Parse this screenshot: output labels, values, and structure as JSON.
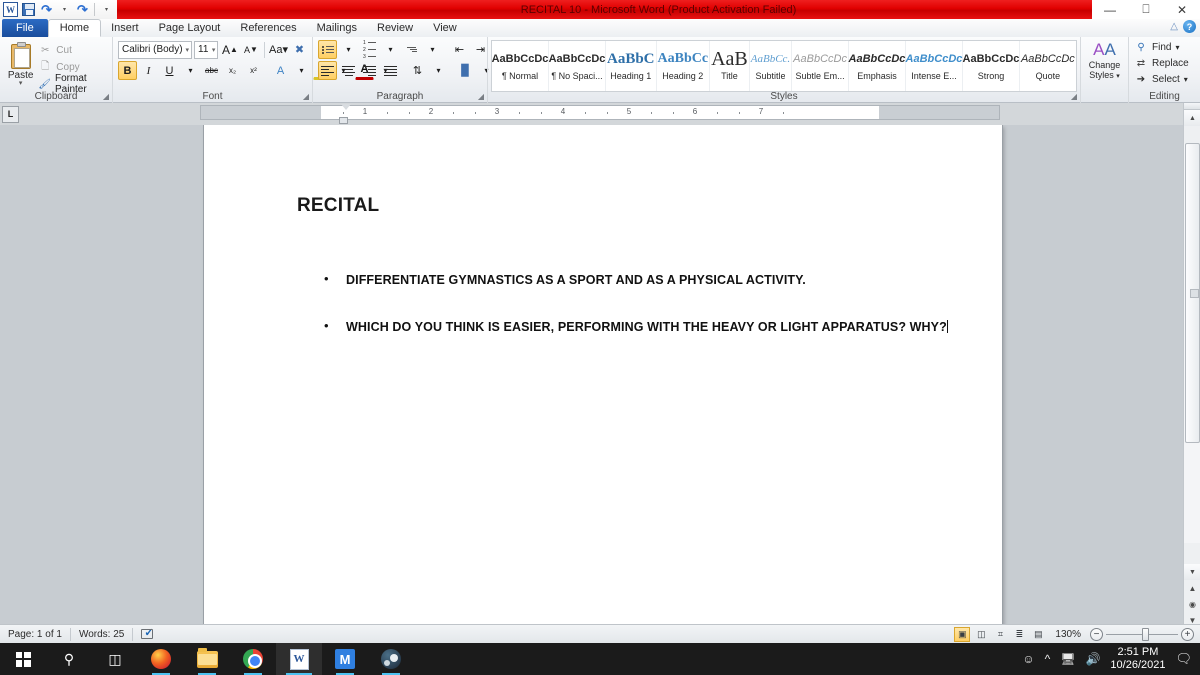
{
  "window": {
    "title": "RECITAL 10  -  Microsoft Word (Product Activation Failed)",
    "minimize": "—",
    "restore": "❐",
    "close": "✕",
    "minimize_ribbon_icon": "chevron-up-icon",
    "help_icon": "?"
  },
  "quick_access": {
    "word_icon": "W",
    "save_icon": "save-icon",
    "undo_icon": "↶",
    "redo_icon": "↷",
    "customize_icon": "▾"
  },
  "tabs": [
    {
      "label": "File",
      "active": false
    },
    {
      "label": "Home",
      "active": true
    },
    {
      "label": "Insert",
      "active": false
    },
    {
      "label": "Page Layout",
      "active": false
    },
    {
      "label": "References",
      "active": false
    },
    {
      "label": "Mailings",
      "active": false
    },
    {
      "label": "Review",
      "active": false
    },
    {
      "label": "View",
      "active": false
    }
  ],
  "ribbon": {
    "clipboard": {
      "group_label": "Clipboard",
      "paste_label": "Paste",
      "paste_caret": "▾",
      "cut_label": "Cut",
      "copy_label": "Copy",
      "format_painter_label": "Format Painter"
    },
    "font": {
      "group_label": "Font",
      "font_name": "Calibri (Body)",
      "font_size": "11",
      "grow_font": "A",
      "shrink_font": "A",
      "change_case": "Aa",
      "clear_formatting": "clear-formatting-icon",
      "bold": "B",
      "italic": "I",
      "underline": "U",
      "strikethrough": "abc",
      "subscript": "x₂",
      "superscript": "x²",
      "text_effects": "A",
      "highlight": "highlight-icon",
      "font_color": "A"
    },
    "paragraph": {
      "group_label": "Paragraph",
      "bullets": "bullets-icon",
      "numbering": "numbering-icon",
      "multilevel": "multilevel-list-icon",
      "decrease_indent": "decrease-indent-icon",
      "increase_indent": "increase-indent-icon",
      "sort": "sort-icon",
      "show_marks": "¶",
      "align_left": "align-left-icon",
      "align_center": "align-center-icon",
      "align_right": "align-right-icon",
      "justify": "justify-icon",
      "line_spacing": "line-spacing-icon",
      "shading": "shading-icon",
      "borders": "borders-icon"
    },
    "styles": {
      "group_label": "Styles",
      "items": [
        {
          "preview": "AaBbCcDc",
          "name": "¶ Normal"
        },
        {
          "preview": "AaBbCcDc",
          "name": "¶ No Spaci..."
        },
        {
          "preview": "AaBbC",
          "name": "Heading 1"
        },
        {
          "preview": "AaBbCc",
          "name": "Heading 2"
        },
        {
          "preview": "AaB",
          "name": "Title"
        },
        {
          "preview": "AaBbCc.",
          "name": "Subtitle"
        },
        {
          "preview": "AaBbCcDc",
          "name": "Subtle Em..."
        },
        {
          "preview": "AaBbCcDc",
          "name": "Emphasis"
        },
        {
          "preview": "AaBbCcDc",
          "name": "Intense E..."
        },
        {
          "preview": "AaBbCcDc",
          "name": "Strong"
        },
        {
          "preview": "AaBbCcDc",
          "name": "Quote"
        }
      ],
      "scroll_up": "▴",
      "scroll_down": "▾",
      "more": "▾"
    },
    "change_styles": {
      "label_line1": "Change",
      "label_line2": "Styles",
      "caret": "▾"
    },
    "editing": {
      "group_label": "Editing",
      "find_label": "Find",
      "find_caret": "▾",
      "replace_label": "Replace",
      "select_label": "Select",
      "select_caret": "▾"
    }
  },
  "ruler": {
    "tab_selector": "L",
    "numbers": [
      "1",
      "2",
      "3",
      "4",
      "5",
      "6",
      "7"
    ]
  },
  "document": {
    "title": "RECITAL",
    "bullet_marker": "•",
    "bullets": [
      {
        "text": "DIFFERENTIATE GYMNASTICS AS A SPORT AND AS A PHYSICAL ACTIVITY."
      },
      {
        "text": "WHICH DO YOU THINK IS EASIER, PERFORMING WITH THE HEAVY OR LIGHT APPARATUS? WHY?"
      }
    ]
  },
  "status_bar": {
    "page": "Page: 1 of 1",
    "words": "Words: 25",
    "proofing_icon": "proofing-errors-icon",
    "views": [
      {
        "name": "print-layout-view",
        "glyph": "▣",
        "active": true
      },
      {
        "name": "full-screen-reading-view",
        "glyph": "◫",
        "active": false
      },
      {
        "name": "web-layout-view",
        "glyph": "⌗",
        "active": false
      },
      {
        "name": "outline-view",
        "glyph": "≣",
        "active": false
      },
      {
        "name": "draft-view",
        "glyph": "▤",
        "active": false
      }
    ],
    "zoom_out": "−",
    "zoom_in": "+",
    "zoom_level": "130%"
  },
  "taskbar": {
    "items": [
      {
        "name": "start-button",
        "label": "Start"
      },
      {
        "name": "search-icon",
        "label": "Search"
      },
      {
        "name": "task-view-icon",
        "label": "Task View"
      },
      {
        "name": "firefox-icon",
        "label": "Firefox"
      },
      {
        "name": "file-explorer-icon",
        "label": "File Explorer"
      },
      {
        "name": "chrome-icon",
        "label": "Google Chrome"
      },
      {
        "name": "word-icon",
        "label": "Microsoft Word"
      },
      {
        "name": "m-app-icon",
        "label": "M"
      },
      {
        "name": "steam-icon",
        "label": "Steam"
      }
    ],
    "tray": {
      "people_icon": "ʘ",
      "show_hidden_icon": "∧",
      "network_icon": "⌨",
      "volume_icon": "ᴘ",
      "time": "2:51 PM",
      "date": "10/26/2021",
      "notifications_icon": "὚9"
    }
  },
  "colors": {
    "title_red": "#e00000",
    "file_tab_blue": "#1a4d9c",
    "accent_gold": "#ffcf63",
    "taskbar": "#1b1b1b",
    "doc_gray": "#c7ccd1"
  }
}
